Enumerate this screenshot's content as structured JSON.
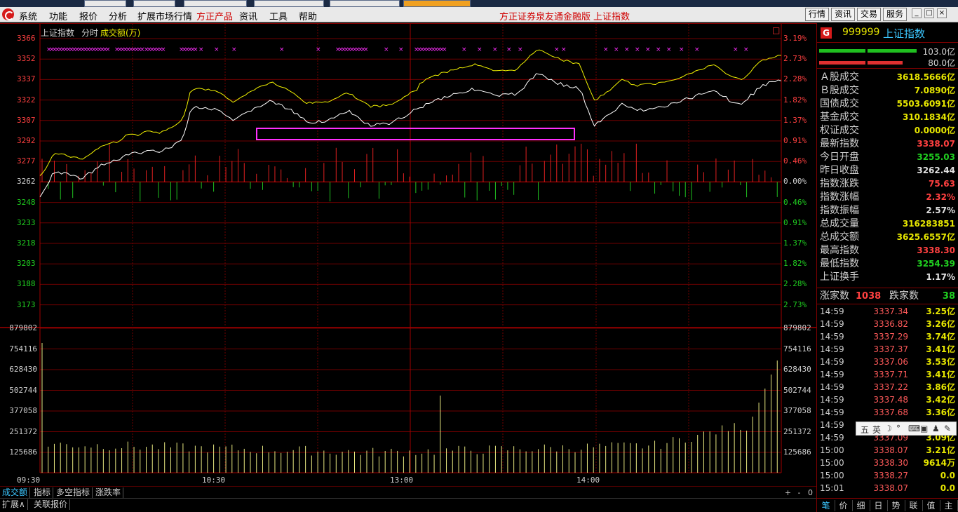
{
  "menu": {
    "items": [
      "系统",
      "功能",
      "报价",
      "分析",
      "扩展市场行情",
      "方正产品",
      "资讯",
      "工具",
      "帮助"
    ],
    "center_title": "方正证券泉友通金融版",
    "center_subtitle": "上证指数",
    "right_buttons": [
      "行情",
      "资讯",
      "交易",
      "服务"
    ],
    "window_buttons": [
      "_",
      "□",
      "×"
    ]
  },
  "chart": {
    "caption_index": "上证指数",
    "caption_mode": "分时",
    "caption_metric": "成交额(万)",
    "price_labels": [
      "3366",
      "3352",
      "3337",
      "3322",
      "3307",
      "3292",
      "3277",
      "3262",
      "3248",
      "3233",
      "3218",
      "3203",
      "3188",
      "3173"
    ],
    "pct_labels": [
      "3.19%",
      "2.73%",
      "2.28%",
      "1.82%",
      "1.37%",
      "0.91%",
      "0.46%",
      "0.00%",
      "0.46%",
      "0.91%",
      "1.37%",
      "1.82%",
      "2.28%",
      "2.73%"
    ],
    "volume_labels": [
      "879802",
      "754116",
      "628430",
      "502744",
      "377058",
      "251372",
      "125686"
    ],
    "time_labels": [
      "09:30",
      "10:30",
      "13:00",
      "14:00"
    ],
    "collapse_icon": "□"
  },
  "bottom_tabs": [
    "成交额",
    "指标",
    "多空指标",
    "涨跌率"
  ],
  "bottom_buttons": [
    "+",
    "-",
    "0"
  ],
  "bottom_tabs2": [
    "扩展∧",
    "关联报价"
  ],
  "panel": {
    "logo": "G",
    "code": "999999",
    "name": "上证指数",
    "bar1_value": "103.0亿",
    "bar2_value": "80.0亿",
    "stats": [
      {
        "label": "Ａ股成交",
        "value": "3618.5666亿",
        "color": "#e6e600"
      },
      {
        "label": "Ｂ股成交",
        "value": "7.0890亿",
        "color": "#e6e600"
      },
      {
        "label": "国债成交",
        "value": "5503.6091亿",
        "color": "#e6e600"
      },
      {
        "label": "基金成交",
        "value": "310.1834亿",
        "color": "#e6e600"
      },
      {
        "label": "权证成交",
        "value": "0.0000亿",
        "color": "#e6e600"
      },
      {
        "label": "最新指数",
        "value": "3338.07",
        "color": "#ff4040"
      },
      {
        "label": "今日开盘",
        "value": "3255.03",
        "color": "#20d020"
      },
      {
        "label": "昨日收盘",
        "value": "3262.44",
        "color": "#e0e0e0"
      },
      {
        "label": "指数涨跌",
        "value": "75.63",
        "color": "#ff4040"
      },
      {
        "label": "指数涨幅",
        "value": "2.32%",
        "color": "#ff4040"
      },
      {
        "label": "指数振幅",
        "value": "2.57%",
        "color": "#e0e0e0"
      },
      {
        "label": "总成交量",
        "value": "316283851",
        "color": "#e6e600"
      },
      {
        "label": "总成交额",
        "value": "3625.6557亿",
        "color": "#e6e600"
      },
      {
        "label": "最高指数",
        "value": "3338.30",
        "color": "#ff4040"
      },
      {
        "label": "最低指数",
        "value": "3254.39",
        "color": "#20d020"
      },
      {
        "label": "上证换手",
        "value": "1.17%",
        "color": "#e0e0e0"
      }
    ],
    "rise_label": "涨家数",
    "rise_count": "1038",
    "fall_label": "跌家数",
    "fall_count": "38",
    "ticks": [
      {
        "time": "14:59",
        "price": "3337.34",
        "amount": "3.25亿"
      },
      {
        "time": "14:59",
        "price": "3336.82",
        "amount": "3.26亿"
      },
      {
        "time": "14:59",
        "price": "3337.29",
        "amount": "3.74亿"
      },
      {
        "time": "14:59",
        "price": "3337.37",
        "amount": "3.41亿"
      },
      {
        "time": "14:59",
        "price": "3337.06",
        "amount": "3.53亿"
      },
      {
        "time": "14:59",
        "price": "3337.71",
        "amount": "3.41亿"
      },
      {
        "time": "14:59",
        "price": "3337.22",
        "amount": "3.86亿"
      },
      {
        "time": "14:59",
        "price": "3337.48",
        "amount": "3.42亿"
      },
      {
        "time": "14:59",
        "price": "3337.68",
        "amount": "3.36亿"
      },
      {
        "time": "14:59",
        "price": "",
        "amount": ""
      },
      {
        "time": "14:59",
        "price": "3337.09",
        "amount": "3.09亿"
      },
      {
        "time": "15:00",
        "price": "3338.07",
        "amount": "3.21亿"
      },
      {
        "time": "15:00",
        "price": "3338.30",
        "amount": "9614万"
      },
      {
        "time": "15:00",
        "price": "3338.27",
        "amount": "0.0"
      },
      {
        "time": "15:01",
        "price": "3338.07",
        "amount": "0.0"
      }
    ],
    "tabs": [
      "笔",
      "价",
      "细",
      "日",
      "势",
      "联",
      "值",
      "主"
    ]
  },
  "ime": {
    "items": [
      "五",
      "英",
      "☽",
      "°",
      "⌨",
      "▣",
      "♟",
      "✎"
    ]
  }
}
